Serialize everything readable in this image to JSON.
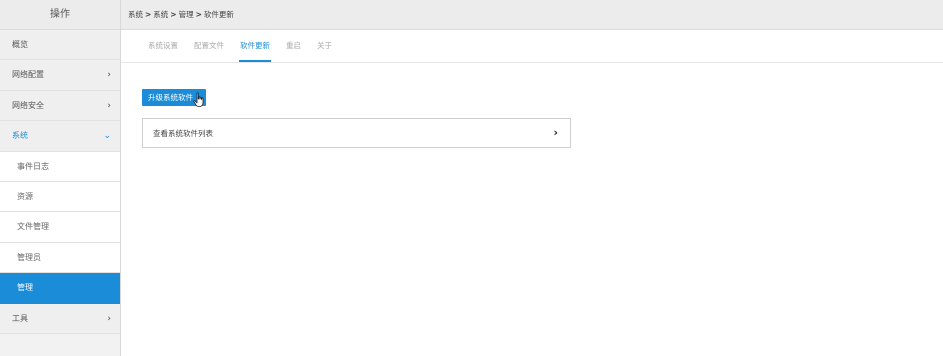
{
  "sidebar": {
    "header": "操作",
    "items": [
      {
        "label": "概览"
      },
      {
        "label": "网络配置",
        "chevron": "›"
      },
      {
        "label": "网络安全",
        "chevron": "›"
      },
      {
        "label": "系统",
        "chevron": "⌄"
      },
      {
        "label": "事件日志"
      },
      {
        "label": "资源"
      },
      {
        "label": "文件管理"
      },
      {
        "label": "管理员"
      },
      {
        "label": "管理"
      },
      {
        "label": "工具",
        "chevron": "›"
      }
    ]
  },
  "breadcrumb": {
    "items": [
      "系统",
      "系统",
      "管理",
      "软件更新"
    ],
    "separator": ">"
  },
  "tabs": [
    {
      "label": "系统设置"
    },
    {
      "label": "配置文件"
    },
    {
      "label": "软件更新"
    },
    {
      "label": "重启"
    },
    {
      "label": "关于"
    }
  ],
  "main": {
    "upgrade_button": "升级系统软件",
    "list_row_label": "查看系统软件列表",
    "list_row_arrow": "›"
  },
  "colors": {
    "accent": "#1a8cd8"
  },
  "icons": {
    "cursor": "hand-pointer-icon"
  }
}
